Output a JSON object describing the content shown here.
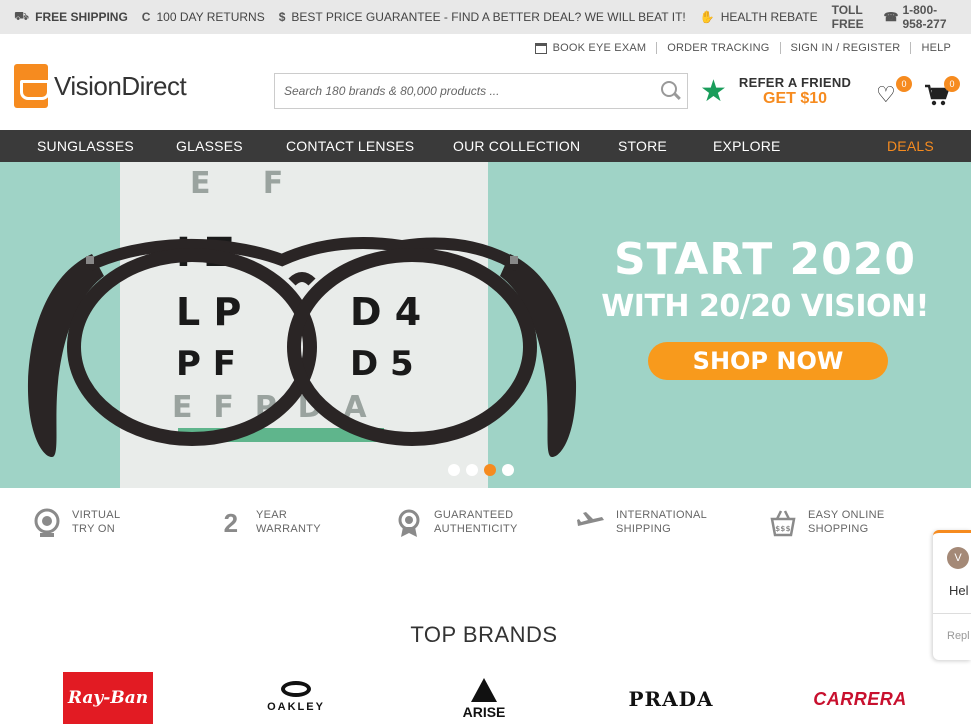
{
  "topbar": {
    "shipping": "FREE SHIPPING",
    "returns": "100 DAY RETURNS",
    "guarantee": "BEST PRICE GUARANTEE - FIND A BETTER DEAL? WE WILL BEAT IT!",
    "rebate": "HEALTH REBATE",
    "toll_label": "TOLL FREE",
    "toll_number": "1-800-958-277"
  },
  "util_links": {
    "eye_exam": "BOOK EYE EXAM",
    "tracking": "ORDER TRACKING",
    "signin": "SIGN IN / REGISTER",
    "help": "HELP"
  },
  "header": {
    "logo": "VisionDirect",
    "search_placeholder": "Search 180 brands & 80,000 products ...",
    "refer_line1": "REFER A FRIEND",
    "refer_line2": "GET $10",
    "wishlist_count": "0",
    "cart_count": "0"
  },
  "nav": {
    "items": [
      "SUNGLASSES",
      "GLASSES",
      "CONTACT LENSES",
      "OUR COLLECTION",
      "STORE",
      "EXPLORE",
      "DEALS"
    ]
  },
  "hero": {
    "title1": "START 2020",
    "title2": "WITH 20/20 VISION!",
    "cta": "SHOP NOW",
    "chart_letters": {
      "row1": "I  Z",
      "row2a": "L P",
      "row2b": "D 4",
      "row3a": "P F",
      "row3b": "D 5"
    },
    "active_slide": 3,
    "slide_count": 4
  },
  "features": {
    "f1": "VIRTUAL TRY ON",
    "f2_num": "2",
    "f2": "YEAR WARRANTY",
    "f3": "GUARANTEED AUTHENTICITY",
    "f4": "INTERNATIONAL SHIPPING",
    "f5": "EASY ONLINE SHOPPING"
  },
  "brands": {
    "title": "TOP BRANDS",
    "rayban": "Ray-Ban",
    "oakley": "OAKLEY",
    "arise": "ARISE",
    "prada": "PRADA",
    "carrera": "CARRERA"
  },
  "chat": {
    "avatar": "V",
    "greeting": "Hel",
    "reply": "Repl"
  },
  "colors": {
    "accent": "#f68b1f",
    "nav_bg": "#3a3a3a",
    "hero_bg": "#9fd3c6",
    "star": "#1a9d5b"
  }
}
